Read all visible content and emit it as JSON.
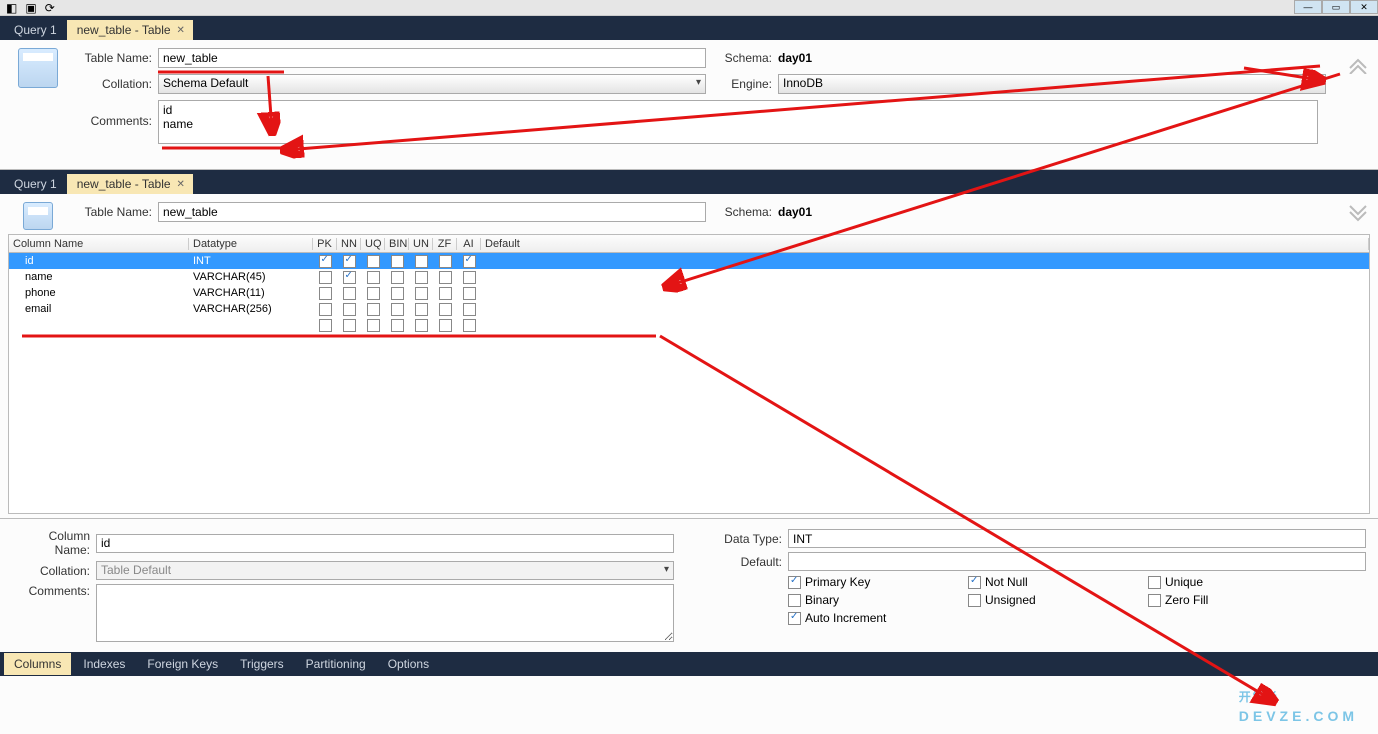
{
  "tabs1": {
    "query": "Query 1",
    "table": "new_table - Table"
  },
  "panel1": {
    "table_name_label": "Table Name:",
    "table_name_value": "new_table",
    "schema_label": "Schema:",
    "schema_value": "day01",
    "collation_label": "Collation:",
    "collation_value": "Schema Default",
    "engine_label": "Engine:",
    "engine_value": "InnoDB",
    "comments_label": "Comments:",
    "comments_value": "id\nname"
  },
  "tabs2": {
    "query": "Query 1",
    "table": "new_table - Table"
  },
  "panel2": {
    "table_name_label": "Table Name:",
    "table_name_value": "new_table",
    "schema_label": "Schema:",
    "schema_value": "day01"
  },
  "cols": {
    "headers": {
      "name": "Column Name",
      "dtype": "Datatype",
      "pk": "PK",
      "nn": "NN",
      "uq": "UQ",
      "bin": "BIN",
      "un": "UN",
      "zf": "ZF",
      "ai": "AI",
      "def": "Default"
    },
    "rows": [
      {
        "name": "id",
        "dtype": "INT",
        "pk": true,
        "nn": true,
        "uq": false,
        "bin": false,
        "un": false,
        "zf": false,
        "ai": true,
        "def": "",
        "selected": true
      },
      {
        "name": "name",
        "dtype": "VARCHAR(45)",
        "pk": false,
        "nn": true,
        "uq": false,
        "bin": false,
        "un": false,
        "zf": false,
        "ai": false,
        "def": "",
        "selected": false
      },
      {
        "name": "phone",
        "dtype": "VARCHAR(11)",
        "pk": false,
        "nn": false,
        "uq": false,
        "bin": false,
        "un": false,
        "zf": false,
        "ai": false,
        "def": "",
        "selected": false
      },
      {
        "name": "email",
        "dtype": "VARCHAR(256)",
        "pk": false,
        "nn": false,
        "uq": false,
        "bin": false,
        "un": false,
        "zf": false,
        "ai": false,
        "def": "",
        "selected": false
      }
    ]
  },
  "detail": {
    "col_name_label": "Column Name:",
    "col_name_value": "id",
    "collation_label": "Collation:",
    "collation_value": "Table Default",
    "comments_label": "Comments:",
    "comments_value": "",
    "datatype_label": "Data Type:",
    "datatype_value": "INT",
    "default_label": "Default:",
    "default_value": "",
    "checks": {
      "pk": {
        "label": "Primary Key",
        "on": true
      },
      "nn": {
        "label": "Not Null",
        "on": true
      },
      "uq": {
        "label": "Unique",
        "on": false
      },
      "bi": {
        "label": "Binary",
        "on": false
      },
      "us": {
        "label": "Unsigned",
        "on": false
      },
      "zf": {
        "label": "Zero Fill",
        "on": false
      },
      "ai": {
        "label": "Auto Increment",
        "on": true
      }
    }
  },
  "bottom_tabs": [
    "Columns",
    "Indexes",
    "Foreign Keys",
    "Triggers",
    "Partitioning",
    "Options"
  ],
  "watermark": {
    "l1": "开发者",
    "l2": "DEVZE.COM"
  }
}
